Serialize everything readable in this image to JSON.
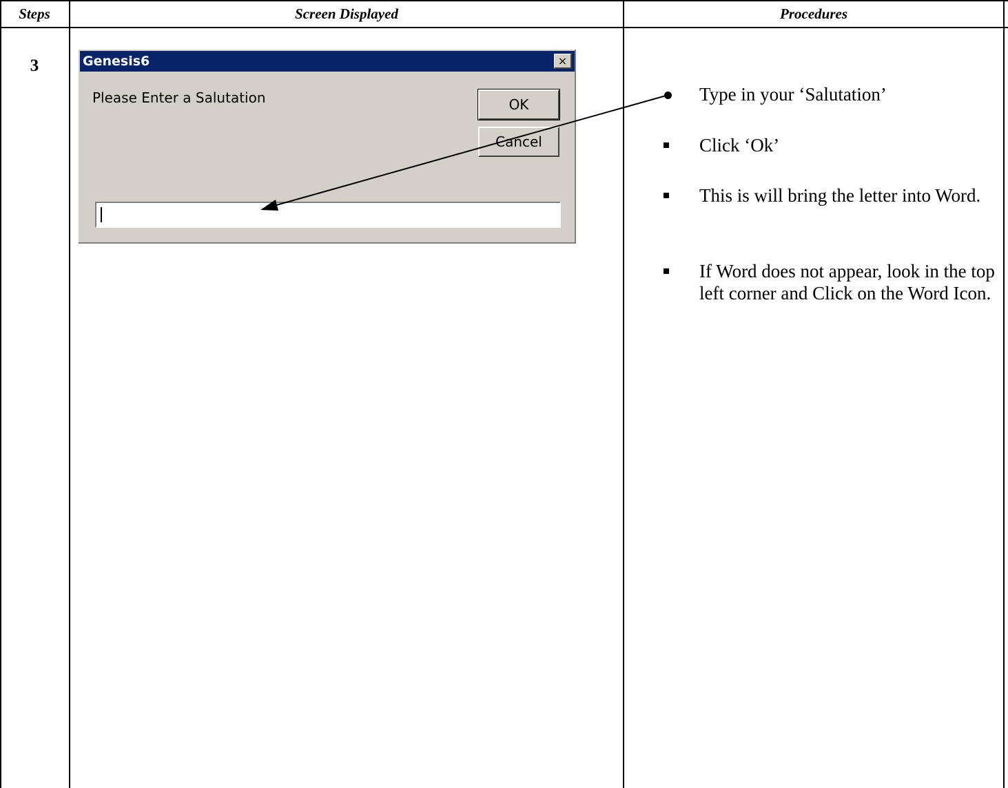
{
  "table": {
    "headers": [
      "Steps",
      "Screen Displayed",
      "Procedures"
    ],
    "step_number": "3"
  },
  "dialog": {
    "title": "Genesis6",
    "close_glyph": "×",
    "prompt": "Please Enter a Salutation",
    "ok_label": "OK",
    "cancel_label": "Cancel",
    "input_value": ""
  },
  "procedures": [
    "Type in your ‘Salutation’",
    "Click ‘Ok’",
    "This is will bring the letter into Word.",
    "If Word does not appear, look in the top left corner and Click on the Word Icon."
  ]
}
